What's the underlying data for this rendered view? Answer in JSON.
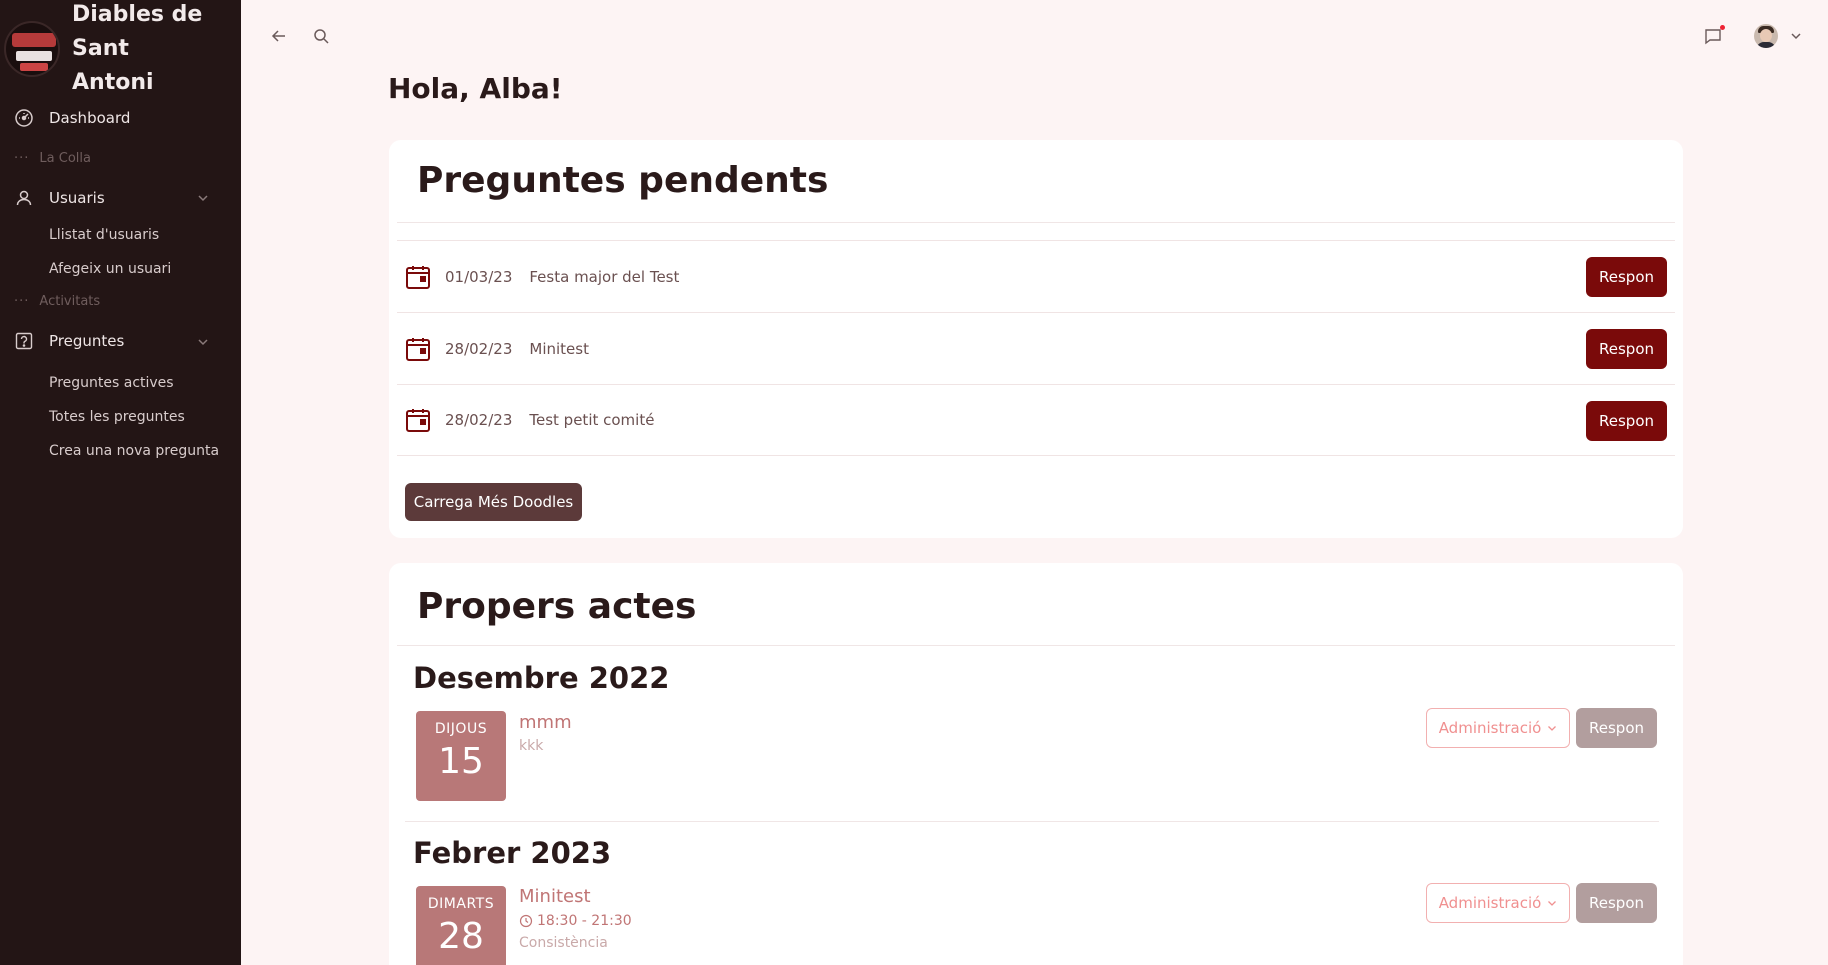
{
  "sidebar": {
    "brand_title": "Diables de Sant Antoni",
    "items": {
      "dashboard": "Dashboard",
      "la_colla": "La Colla",
      "usuaris": "Usuaris",
      "llistat_usuaris": "Llistat d'usuaris",
      "afegeix_usuari": "Afegeix un usuari",
      "activitats": "Activitats",
      "preguntes": "Preguntes",
      "preguntes_actives": "Preguntes actives",
      "totes_preguntes": "Totes les preguntes",
      "crea_pregunta": "Crea una nova pregunta"
    }
  },
  "greeting": "Hola, Alba!",
  "pending": {
    "title": "Preguntes pendents",
    "rows": [
      {
        "date": "01/03/23",
        "name": "Festa major del Test",
        "button": "Respon"
      },
      {
        "date": "28/02/23",
        "name": "Minitest",
        "button": "Respon"
      },
      {
        "date": "28/02/23",
        "name": "Test petit comité",
        "button": "Respon"
      }
    ],
    "load_more": "Carrega Més Doodles"
  },
  "upcoming": {
    "title": "Propers actes",
    "months": [
      {
        "label": "Desembre 2022",
        "event": {
          "weekday": "DIJOUS",
          "day": "15",
          "title": "mmm",
          "subtitle": "kkk",
          "admin": "Administració",
          "respon": "Respon"
        }
      },
      {
        "label": "Febrer 2023",
        "event": {
          "weekday": "DIMARTS",
          "day": "28",
          "title": "Minitest",
          "time": "18:30 - 21:30",
          "subtitle": "Consistència",
          "admin": "Administració",
          "respon": "Respon"
        }
      }
    ]
  },
  "colors": {
    "sidebar": "#231515",
    "primary": "#7a0a0a",
    "background": "#fdf4f4",
    "daybox": "#b87878"
  }
}
